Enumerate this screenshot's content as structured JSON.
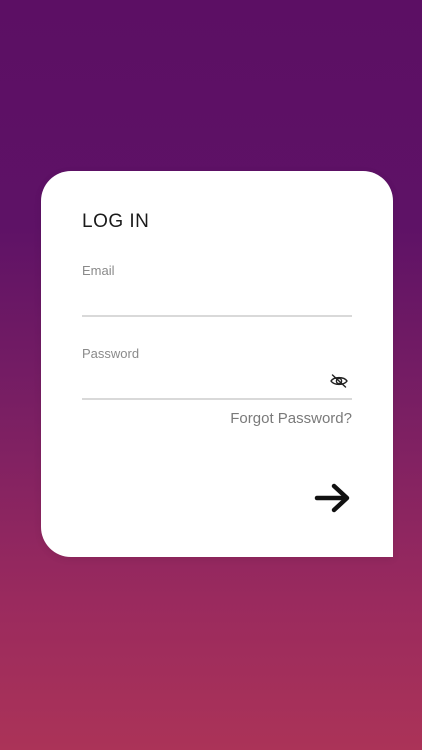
{
  "login": {
    "title": "LOG IN",
    "email_label": "Email",
    "email_value": "",
    "password_label": "Password",
    "password_value": "",
    "forgot_label": "Forgot Password?",
    "submit_icon": "arrow-right-icon",
    "visibility_icon": "eye-off-icon"
  },
  "colors": {
    "background_top": "#5c0f64",
    "background_bottom": "#ab3358",
    "card": "#ffffff",
    "underline": "#d9d9d9",
    "label": "#8a8a8a"
  }
}
